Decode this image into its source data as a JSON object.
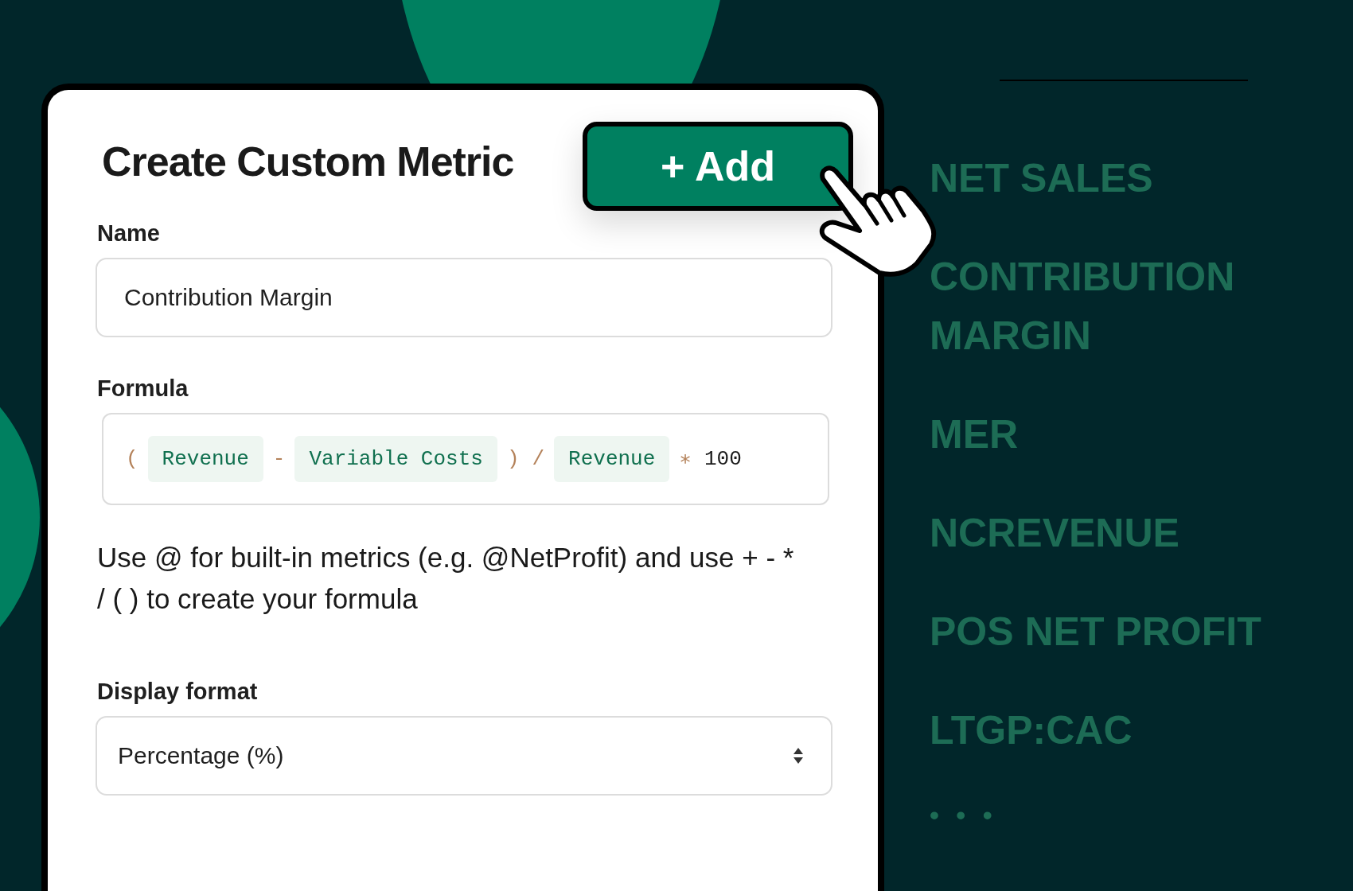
{
  "card": {
    "title": "Create Custom Metric",
    "add_button": "+ Add",
    "name_field": {
      "label": "Name",
      "value": "Contribution Margin"
    },
    "formula_field": {
      "label": "Formula",
      "tokens": [
        {
          "kind": "op",
          "text": "("
        },
        {
          "kind": "metric",
          "text": "Revenue"
        },
        {
          "kind": "op",
          "text": "-"
        },
        {
          "kind": "metric",
          "text": "Variable Costs"
        },
        {
          "kind": "op",
          "text": ")"
        },
        {
          "kind": "op",
          "text": "/"
        },
        {
          "kind": "metric",
          "text": "Revenue"
        },
        {
          "kind": "op",
          "text": "∗"
        },
        {
          "kind": "number",
          "text": "100"
        }
      ]
    },
    "help_text": "Use @ for built-in metrics (e.g. @NetProfit) and use + - * / ( ) to create your formula",
    "display_format": {
      "label": "Display format",
      "value": "Percentage (%)"
    }
  },
  "metrics": [
    "NET SALES",
    "CONTRIBUTION MARGIN",
    "MER",
    "NCREVENUE",
    "POS NET PROFIT",
    "LTGP:CAC"
  ],
  "more": "• • •"
}
